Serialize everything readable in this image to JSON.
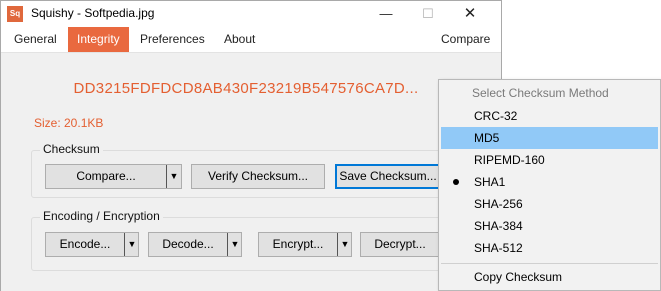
{
  "window": {
    "title": "Squishy - Softpedia.jpg",
    "icon_text": "Sq",
    "minimize_glyph": "—",
    "maximize_glyph": "☐",
    "close_glyph": "✕"
  },
  "menu": {
    "items": [
      "General",
      "Integrity",
      "Preferences",
      "About"
    ],
    "active": "Integrity",
    "right_item": "Compare"
  },
  "main": {
    "hash": "DD3215FDFDCD8AB430F23219B547576CA7D...",
    "size": "Size: 20.1KB",
    "checksum_group": {
      "label": "Checksum",
      "compare": "Compare...",
      "verify": "Verify Checksum...",
      "save": "Save Checksum..."
    },
    "encoding_group": {
      "label": "Encoding / Encryption",
      "encode": "Encode...",
      "decode": "Decode...",
      "encrypt": "Encrypt...",
      "decrypt": "Decrypt..."
    },
    "dropdown_arrow": "▼"
  },
  "checksum_menu": {
    "header": "Select Checksum Method",
    "items": [
      "CRC-32",
      "MD5",
      "RIPEMD-160",
      "SHA1",
      "SHA-256",
      "SHA-384",
      "SHA-512"
    ],
    "highlighted": "MD5",
    "selected": "SHA1",
    "copy": "Copy Checksum"
  },
  "colors": {
    "accent": "#e9693f",
    "hash_text": "#e45f31",
    "menu_highlight": "#91c9f7",
    "focus_border": "#0078d7"
  }
}
